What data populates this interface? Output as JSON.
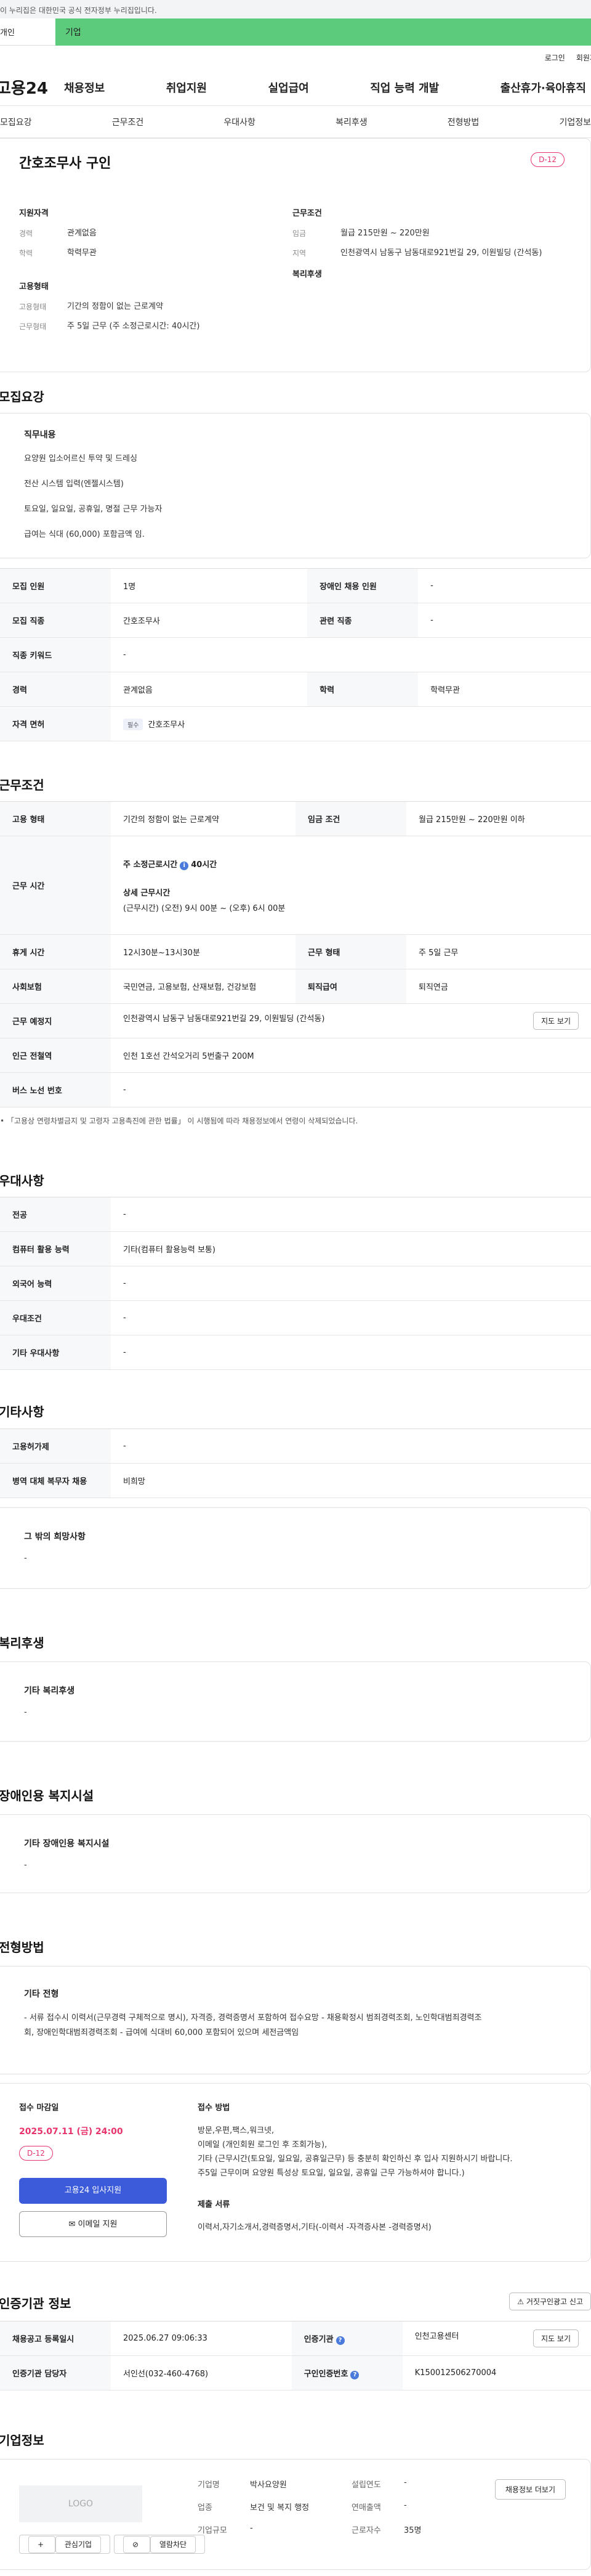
{
  "gov_notice": "이 누리집은 대한민국 공식 전자정부 누리집입니다.",
  "tabs": {
    "person": "개인",
    "company": "기업"
  },
  "util": {
    "login": "로그인",
    "join": "회원가입"
  },
  "logo": "고용24",
  "gnb": [
    "채용정보",
    "취업지원",
    "실업급여",
    "직업 능력 개발",
    "출산휴가·육아휴직"
  ],
  "subnav": [
    "모집요강",
    "근무조건",
    "우대사항",
    "복리후생",
    "전형방법",
    "기업정보"
  ],
  "summary": {
    "title": "간호조무사 구인",
    "dday": "D-12",
    "qual_title": "지원자격",
    "qual": [
      {
        "k": "경력",
        "v": "관계없음"
      },
      {
        "k": "학력",
        "v": "학력무관"
      }
    ],
    "cond_title": "근무조건",
    "cond": [
      {
        "k": "임금",
        "v": "월급 215만원 ~ 220만원"
      },
      {
        "k": "지역",
        "v": "인천광역시 남동구 남동대로921번길 29, 이원빌딩 (간석동)"
      }
    ],
    "emp_title": "고용형태",
    "emp": [
      {
        "k": "고용형태",
        "v": "기간의 정함이 없는 근로계약"
      },
      {
        "k": "근무형태",
        "v": "주 5일 근무 (주 소정근로시간: 40시간)"
      }
    ],
    "welfare_title": "복리후생"
  },
  "recruit": {
    "title": "모집요강",
    "job_title": "직무내용",
    "job_lines": [
      "요양원 입소어르신 투약 및 드레싱",
      "전산 시스템 입력(엔젤시스템)",
      "토요일, 일요일, 공휴일, 명절   근무 가능자",
      "급여는 식대 (60,000)  포함금액 임."
    ],
    "rows": [
      {
        "k1": "모집 인원",
        "v1": "1명",
        "k2": "장애인 채용 인원",
        "v2": "-"
      },
      {
        "k1": "모집 직종",
        "v1": "간호조무사",
        "k2": "관련 직종",
        "v2": "-"
      },
      {
        "k1": "직종 키워드",
        "v1": "-"
      },
      {
        "k1": "경력",
        "v1": "관계없음",
        "k2": "학력",
        "v2": "학력무관"
      }
    ],
    "license_k": "자격 면허",
    "license_chip": "필수",
    "license_v": "간호조무사"
  },
  "work": {
    "title": "근무조건",
    "r1": {
      "k1": "고용 형태",
      "v1": "기간의 정함이 없는 근로계약",
      "k2": "임금 조건",
      "v2": "월급 215만원 ~ 220만원 이하"
    },
    "r2_k": "근무 시간",
    "r2_weekly": "주 소정근로시간",
    "r2_weekly_v": "40시간",
    "r2_detail_title": "상세 근무시간",
    "r2_detail": "(근무시간) (오전) 9시 00분 ~ (오후) 6시 00분",
    "r3": {
      "k1": "휴게 시간",
      "v1": "12시30분~13시30분",
      "k2": "근무 형태",
      "v2": "주 5일 근무"
    },
    "r4": {
      "k1": "사회보험",
      "v1": "국민연금, 고용보험, 산재보험, 건강보험",
      "k2": "퇴직급여",
      "v2": "퇴직연금"
    },
    "r5": {
      "k1": "근무 예정지",
      "v1": "인천광역시 남동구 남동대로921번길 29, 이원빌딩 (간석동)",
      "btn": "지도 보기"
    },
    "r6": {
      "k1": "인근 전철역",
      "v1": "인천 1호선 간석오거리 5번출구 200M"
    },
    "r7": {
      "k1": "버스 노선 번호",
      "v1": "-"
    },
    "note": "「고용상 연령차별금지 및 고령자 고용촉진에 관한 법률」 이 시행됨에 따라 채용정보에서 연령이 삭제되었습니다."
  },
  "pref": {
    "title": "우대사항",
    "rows": [
      {
        "k": "전공",
        "v": "-"
      },
      {
        "k": "컴퓨터 활용 능력",
        "v": "기타(컴퓨터 활용능력 보통)"
      },
      {
        "k": "외국어 능력",
        "v": "-"
      },
      {
        "k": "우대조건",
        "v": "-"
      },
      {
        "k": "기타 우대사항",
        "v": "-"
      }
    ]
  },
  "etc": {
    "title": "기타사항",
    "rows": [
      {
        "k": "고용허가제",
        "v": "-"
      },
      {
        "k": "병역 대체 복무자 채용",
        "v": "비희망"
      }
    ],
    "other_title": "그 밖의 희망사항",
    "other_v": "-"
  },
  "welfare": {
    "title": "복리후생",
    "sub": "기타 복리후생",
    "v": "-"
  },
  "disabled": {
    "title": "장애인용 복지시설",
    "sub": "기타 장애인용 복지시설",
    "v": "-"
  },
  "screening": {
    "title": "전형방법",
    "sub": "기타 전형",
    "lines": [
      "- 서류 접수시 이력서(근무경력 구체적으로 명시), 자격증, 경력증명서 포함하여 접수요망 - 채용확정시 범죄경력조회, 노인학대범죄경력조",
      "회, 장애인학대범죄경력조회 - 급여에 식대비 60,000 포함되어 있으며 세전금액임"
    ]
  },
  "apply": {
    "deadline_label": "접수 마감일",
    "deadline": "2025.07.11 (금) 24:00",
    "dday": "D-12",
    "btn_apply": "고용24 입사지원",
    "btn_email": "이메일 지원",
    "method_label": "접수 방법",
    "method_lines": [
      "방문,우편,팩스,워크넷,",
      "이메일 (개인회원 로그인 후 조회가능),",
      "기타 (근무시간(토요일, 일요일, 공휴일근무)  등 충분히 확인하신 후 입사 지원하시기 바랍니다.",
      "주5일 근무이며 요양원 특성상 토요일, 일요일, 공휴일 근무 가능하셔야 합니다.)"
    ],
    "docs_label": "제출 서류",
    "docs": "이력서,자기소개서,경력증명서,기타(-이력서 -자격증사본 -경력증명서)"
  },
  "certify": {
    "title": "인증기관 정보",
    "report_btn": "거짓구인광고 신고",
    "r1": {
      "k1": "채용공고 등록일시",
      "v1": "2025.06.27 09:06:33",
      "k2": "인증기관",
      "v2": "인천고용센터",
      "btn": "지도 보기"
    },
    "r2": {
      "k1": "인증기관 담당자",
      "v1": "서인선(032-460-4768)",
      "k2": "구인인증번호",
      "v2": "K150012506270004"
    }
  },
  "company": {
    "title": "기업정보",
    "logo_text": "LOGO",
    "fav": "관심기업",
    "block": "열람차단",
    "list_btn": "채용정보 더보기",
    "rows": [
      [
        {
          "k": "기업명",
          "v": "박사요양원"
        },
        {
          "k": "설립연도",
          "v": "-"
        }
      ],
      [
        {
          "k": "업종",
          "v": "보건 및 복지 행정"
        },
        {
          "k": "연매출액",
          "v": "-"
        }
      ],
      [
        {
          "k": "기업규모",
          "v": "-"
        },
        {
          "k": "근로자수",
          "v": "35명"
        }
      ]
    ]
  }
}
